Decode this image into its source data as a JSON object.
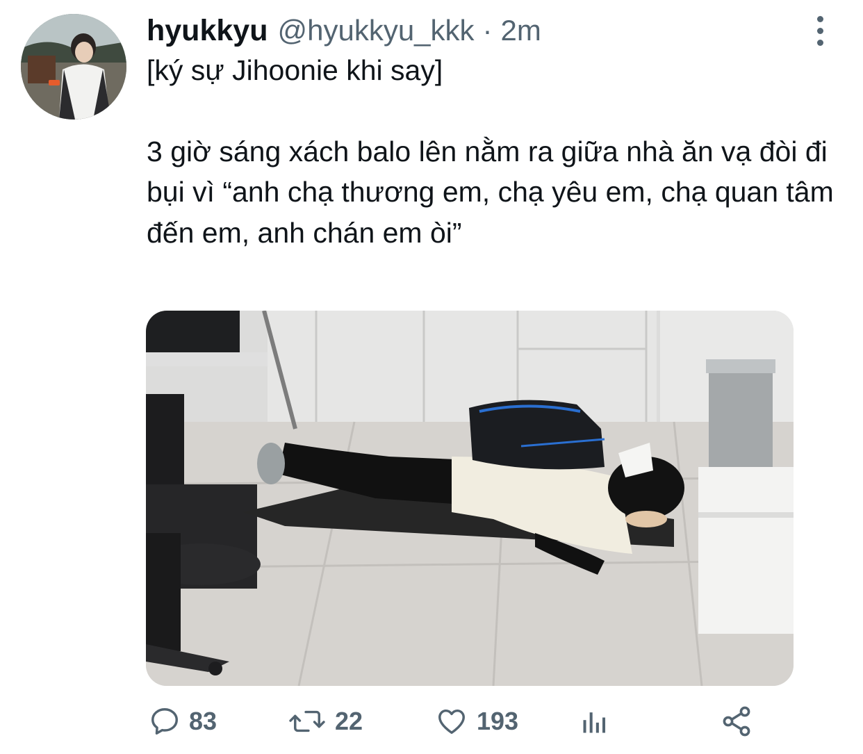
{
  "tweet": {
    "display_name": "hyukkyu",
    "handle": "@hyukkyu_kkk",
    "separator": "·",
    "time": "2m",
    "text_title": "[ký sự Jihoonie khi say]",
    "text_body": "3 giờ sáng xách balo lên nằm ra giữa nhà ăn vạ đòi đi bụi vì “anh chạ thương em, chạ yêu em, chạ quan tâm đến em, anh chán em òi”",
    "avatar_icon": "profile-avatar",
    "media_icon": "photo-person-lying-on-floor-with-backpack"
  },
  "actions": {
    "reply": {
      "icon": "reply-icon",
      "count": "83"
    },
    "retweet": {
      "icon": "retweet-icon",
      "count": "22"
    },
    "like": {
      "icon": "heart-icon",
      "count": "193"
    },
    "analytics": {
      "icon": "analytics-icon"
    },
    "share": {
      "icon": "share-icon"
    }
  },
  "colors": {
    "text_primary": "#0f1419",
    "text_secondary": "#536471",
    "background": "#ffffff"
  }
}
